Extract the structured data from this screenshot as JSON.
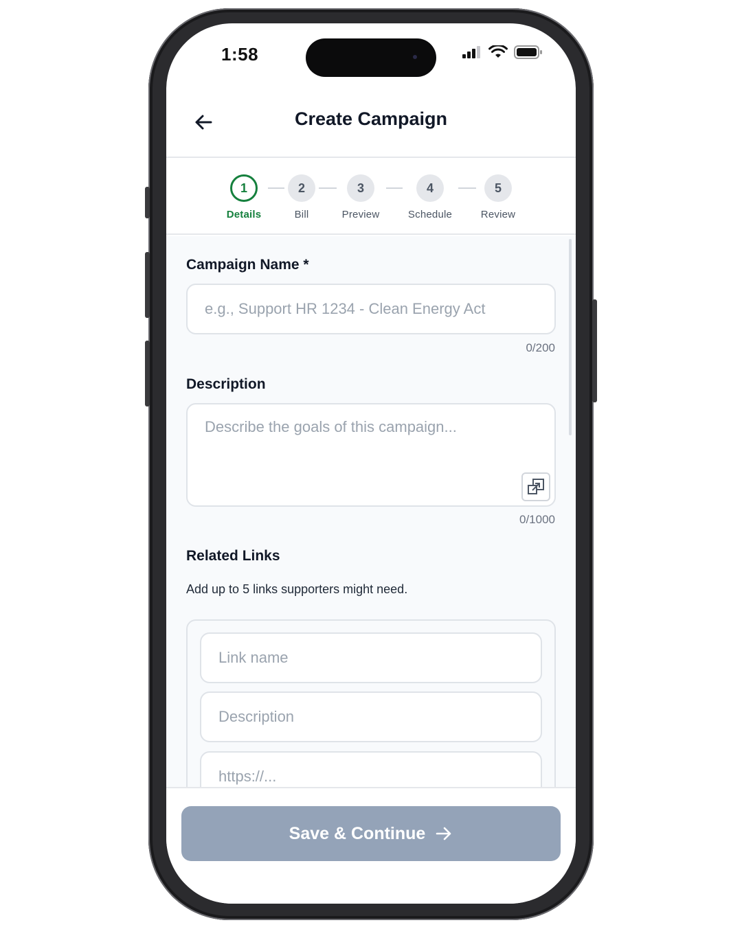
{
  "status_bar": {
    "time": "1:58"
  },
  "header": {
    "title": "Create Campaign",
    "back_icon": "arrow-left-icon"
  },
  "stepper": {
    "steps": [
      {
        "number": "1",
        "label": "Details",
        "active": true
      },
      {
        "number": "2",
        "label": "Bill",
        "active": false
      },
      {
        "number": "3",
        "label": "Preview",
        "active": false
      },
      {
        "number": "4",
        "label": "Schedule",
        "active": false
      },
      {
        "number": "5",
        "label": "Review",
        "active": false
      }
    ]
  },
  "form": {
    "campaign_name": {
      "label": "Campaign Name *",
      "value": "",
      "placeholder": "e.g., Support HR 1234 - Clean Energy Act",
      "counter": "0/200"
    },
    "description": {
      "label": "Description",
      "value": "",
      "placeholder": "Describe the goals of this campaign...",
      "counter": "0/1000"
    },
    "related_links": {
      "label": "Related Links",
      "helper": "Add up to 5 links supporters might need.",
      "link_name_placeholder": "Link name",
      "link_description_placeholder": "Description",
      "link_url_placeholder": "https://..."
    }
  },
  "footer": {
    "save_label": "Save & Continue",
    "save_icon": "arrow-right-icon"
  },
  "colors": {
    "accent": "#15803d",
    "button_disabled": "#94a3b8",
    "background": "#f8fafc"
  }
}
